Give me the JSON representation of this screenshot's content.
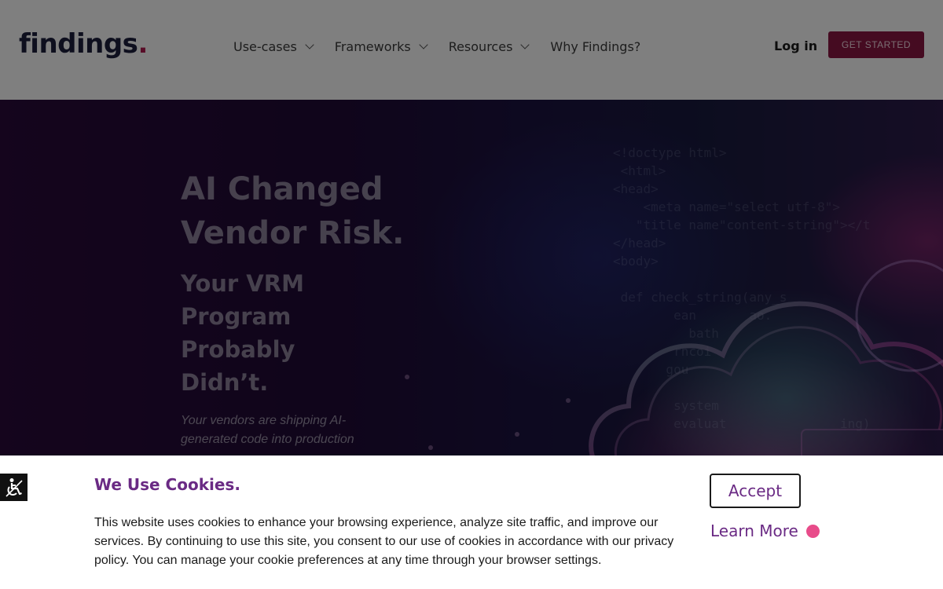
{
  "header": {
    "logo_text": "findings",
    "logo_dot": ".",
    "nav": [
      {
        "label": "Use-cases",
        "has_dropdown": true
      },
      {
        "label": "Frameworks",
        "has_dropdown": true
      },
      {
        "label": "Resources",
        "has_dropdown": true
      },
      {
        "label": "Why Findings?",
        "has_dropdown": false
      }
    ],
    "login_label": "Log in",
    "cta_label": "GET STARTED"
  },
  "hero": {
    "title": "AI Changed\nVendor Risk.",
    "subtitle": "Your VRM Program Probably Didn’t.",
    "body": "Your vendors are shipping AI-generated code into production"
  },
  "cookie_banner": {
    "title": "We Use Cookies.",
    "text": "This website uses cookies to enhance your browsing experience, analyze site traffic, and improve our services. By continuing to use this site, you consent to our use of cookies in accordance with our privacy policy. You can manage your cookie preferences at any time through your browser settings.",
    "accept_label": "Accept",
    "learn_more_label": "Learn More"
  },
  "accessibility": {
    "icon": "wheelchair-icon"
  },
  "colors": {
    "brand": "#8a1743",
    "accent_purple": "#6a2a84",
    "accent_pink": "#e84c8a",
    "hero_bg": "#200a36"
  }
}
